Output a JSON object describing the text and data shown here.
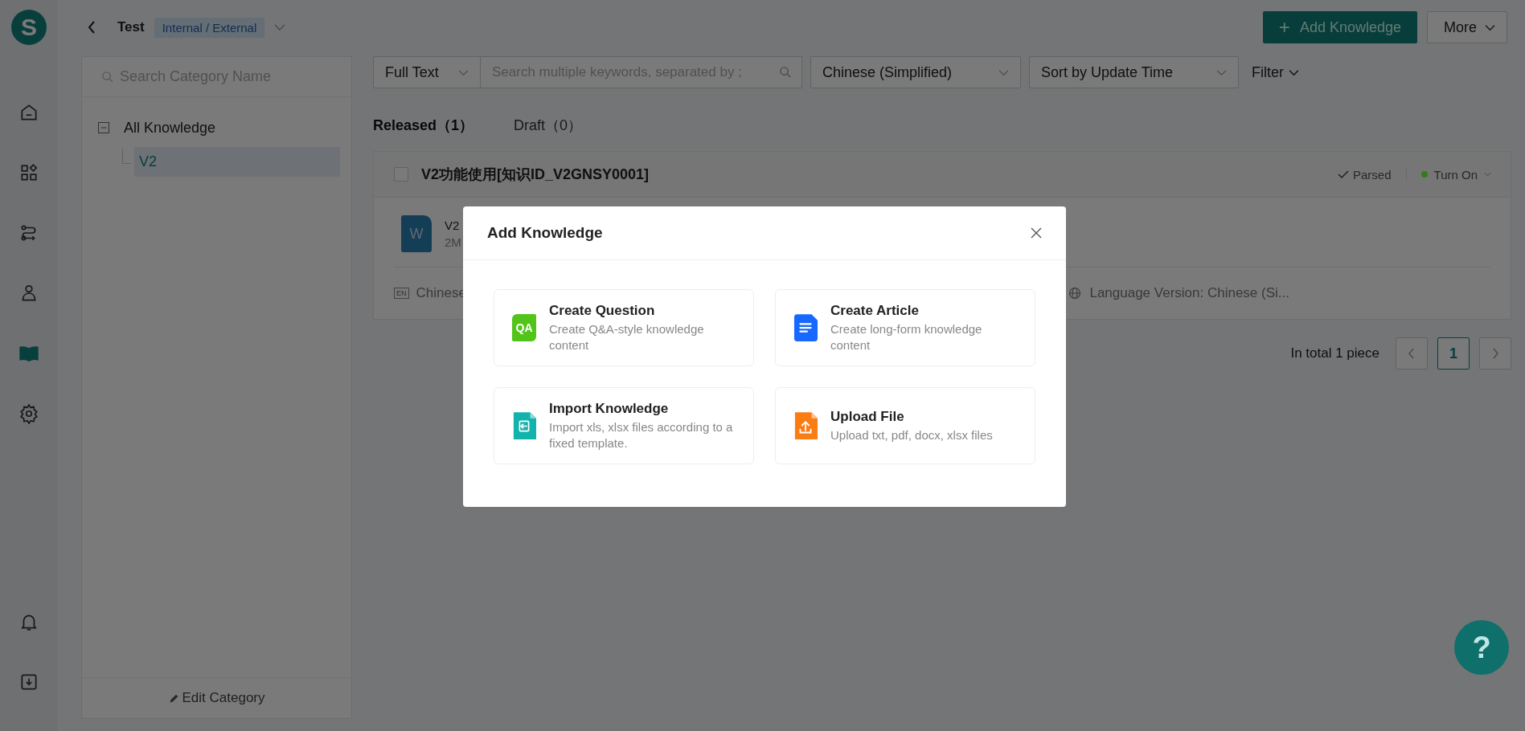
{
  "rail": {
    "logo": "S",
    "items": [
      {
        "kind": "home",
        "selected": false
      },
      {
        "kind": "apps",
        "selected": false
      },
      {
        "kind": "flow",
        "selected": false
      },
      {
        "kind": "person",
        "selected": false
      },
      {
        "kind": "book",
        "selected": true
      },
      {
        "kind": "settings",
        "selected": false
      }
    ],
    "bottom_items": [
      {
        "kind": "bell",
        "selected": false
      },
      {
        "kind": "download",
        "selected": false
      }
    ]
  },
  "header": {
    "title": "Test",
    "tag": "Internal / External"
  },
  "actions": {
    "add_icon": "+",
    "add_button": "Add Knowledge",
    "more_button": "More"
  },
  "category_panel": {
    "search_placeholder": "Search Category Name",
    "tree": [
      {
        "label": "All Knowledge",
        "expanded": true,
        "selected": false,
        "children": [
          {
            "label": "V2",
            "selected": true
          }
        ]
      }
    ],
    "footer_button": "Edit Category"
  },
  "filters": {
    "search_mode": "Full Text",
    "search_placeholder": "Search multiple keywords, separated by ;",
    "language": "Chinese (Simplified)",
    "sort": "Sort by Update Time",
    "filter_button": "Filter"
  },
  "tabs": [
    {
      "label": "Released（1）",
      "selected": true
    },
    {
      "label": "Draft（0）",
      "selected": false
    }
  ],
  "items": [
    {
      "title": "V2功能使用[知识ID_V2GNSY0001]",
      "checked": false,
      "parse_status": "Parsed",
      "toggle": {
        "label": "Turn On",
        "color": "#2f7d1a"
      },
      "file": {
        "type_letter": "W",
        "name": "V2",
        "size": "2M"
      },
      "lang_badge": "EN",
      "footer_left": "Chinese",
      "footer_right": "Language Version: Chinese (Si..."
    }
  ],
  "pagination": {
    "total": "In total 1 piece",
    "pages": [
      {
        "label": "1",
        "selected": true
      }
    ]
  },
  "help_button": "?",
  "modal": {
    "title": "Add Knowledge",
    "options": [
      {
        "kind": "qa",
        "badge": "QA",
        "title": "Create Question",
        "description": "Create Q&A-style knowledge content"
      },
      {
        "kind": "article",
        "title": "Create Article",
        "description": "Create long-form knowledge content"
      },
      {
        "kind": "import",
        "title": "Import Knowledge",
        "description": "Import xls, xlsx files according to a fixed template."
      },
      {
        "kind": "upload",
        "title": "Upload File",
        "description": "Upload txt, pdf, docx, xlsx files"
      }
    ]
  }
}
